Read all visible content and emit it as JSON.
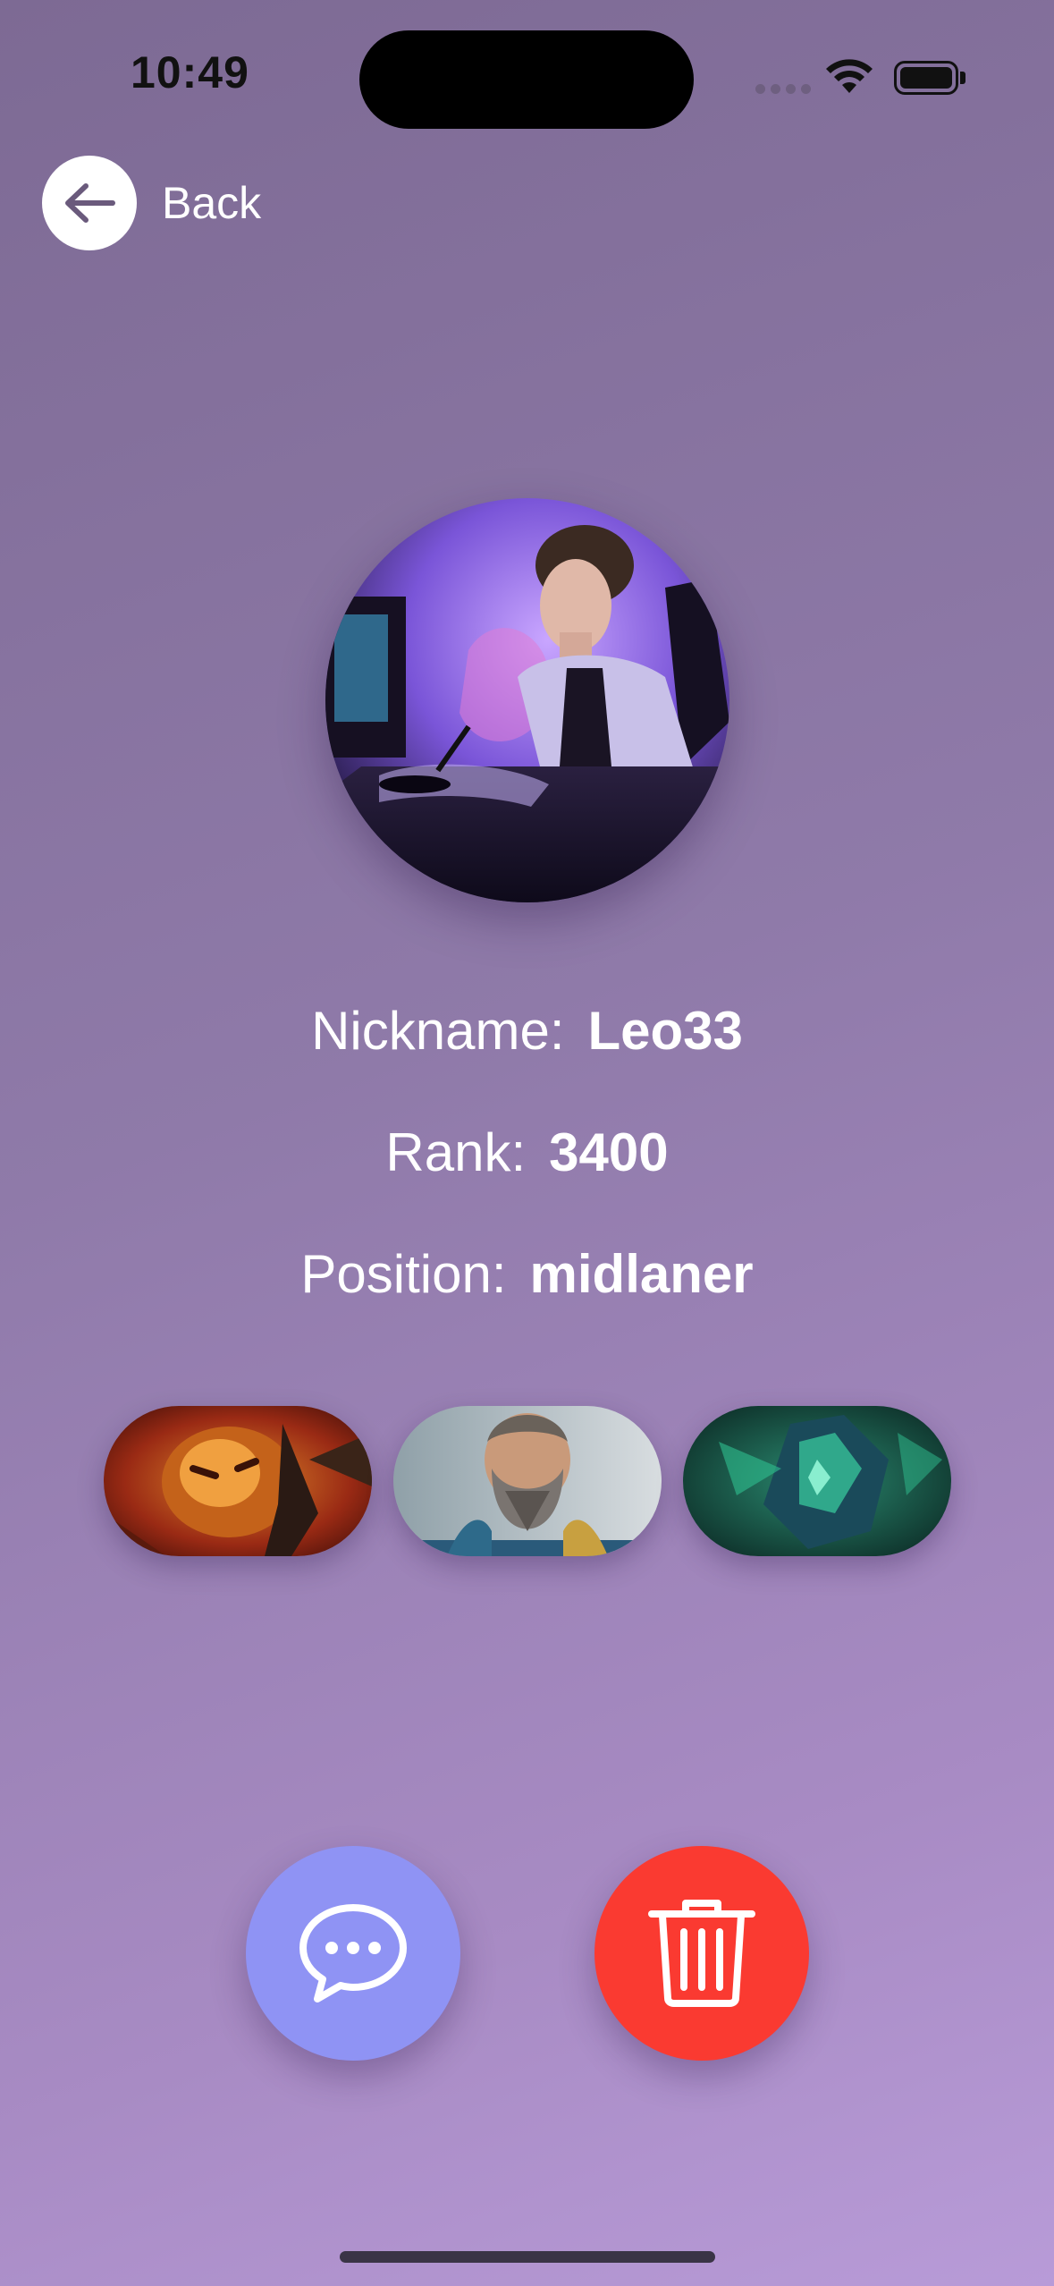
{
  "status_bar": {
    "time": "10:49",
    "icons": [
      "signal-icon",
      "wifi-icon",
      "battery-icon"
    ]
  },
  "nav": {
    "back_label": "Back",
    "back_icon": "arrow-left-icon"
  },
  "profile": {
    "avatar": "gamer-avatar-photo",
    "nickname_label": "Nickname:",
    "nickname_value": "Leo33",
    "rank_label": "Rank:",
    "rank_value": "3400",
    "position_label": "Position:",
    "position_value": "midlaner"
  },
  "heroes": [
    "hero-portrait-ember",
    "hero-portrait-bearded-warrior",
    "hero-portrait-green-beast"
  ],
  "actions": {
    "chat_icon": "chat-bubble-icon",
    "delete_icon": "trash-icon"
  },
  "colors": {
    "chat_button": "#8f93f4",
    "delete_button": "#fa3a31",
    "back_circle": "#ffffff"
  }
}
